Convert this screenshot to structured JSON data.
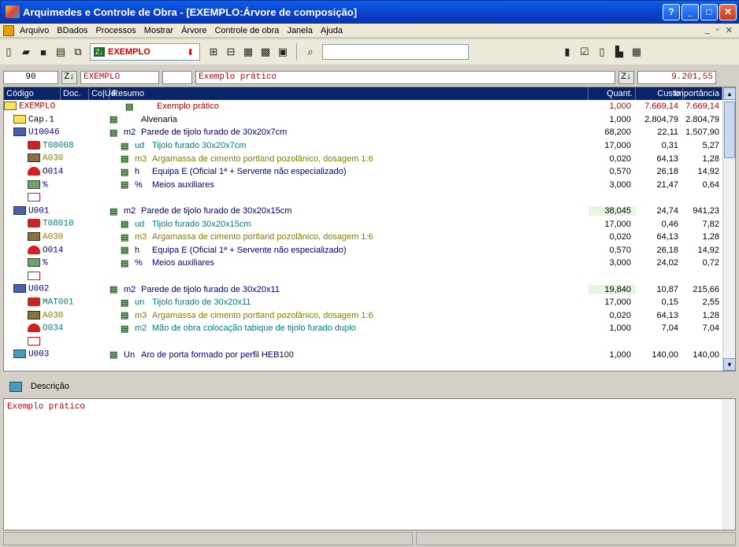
{
  "window": {
    "title": "Arquimedes e Controle de Obra - [EXEMPLO:Árvore de composição]"
  },
  "menu": [
    "Arquivo",
    "BDados",
    "Processos",
    "Mostrar",
    "Árvore",
    "Controle de obra",
    "Janela",
    "Ajuda"
  ],
  "toolbar": {
    "obra_combo": "EXEMPLO"
  },
  "infobar": {
    "count": "90",
    "code": "EXEMPLO",
    "resumo": "Exemplo prático",
    "total": "9.201,55"
  },
  "grid": {
    "headers": {
      "codigo": "Código",
      "doc": "Doc.",
      "col": "Co|Ud",
      "resumo": "Resumo",
      "quant": "Quant.",
      "custo": "Custo",
      "importancia": "Importância"
    },
    "rows": [
      {
        "code": "EXEMPLO",
        "ud": "",
        "resumo": "Exemplo prático",
        "q": "1,000",
        "c": "7.669,14",
        "i": "7.669,14",
        "color": "#c00000",
        "icon": "root",
        "indent": 0
      },
      {
        "code": "Cap.1",
        "ud": "",
        "resumo": "Alvenaria",
        "q": "1,000",
        "c": "2.804,79",
        "i": "2.804,79",
        "color": "#000000",
        "icon": "cap",
        "indent": 1
      },
      {
        "code": "U10046",
        "ud": "m2",
        "resumo": "Parede de tijolo furado de 30x20x7cm",
        "q": "68,200",
        "c": "22,11",
        "i": "1.507,90",
        "color": "#000080",
        "icon": "part",
        "indent": 1
      },
      {
        "code": "T08008",
        "ud": "ud",
        "resumo": "Tijolo furado 30x20x7cm",
        "q": "17,000",
        "c": "0,31",
        "i": "5,27",
        "color": "#008080",
        "icon": "mat",
        "indent": 2
      },
      {
        "code": "A030",
        "ud": "m3",
        "resumo": "Argamassa de cimento portland pozolânico, dosagem 1:6",
        "q": "0,020",
        "c": "64,13",
        "i": "1,28",
        "color": "#808000",
        "icon": "eq",
        "indent": 2
      },
      {
        "code": "O014",
        "ud": "h",
        "resumo": "Equipa E (Oficial 1ª + Servente não especializado)",
        "q": "0,570",
        "c": "26,18",
        "i": "14,92",
        "color": "#000080",
        "icon": "mao",
        "indent": 2
      },
      {
        "code": "%",
        "ud": "%",
        "resumo": "Meios auxiliares",
        "q": "3,000",
        "c": "21,47",
        "i": "0,64",
        "color": "#000080",
        "icon": "pct",
        "indent": 2
      },
      {
        "code": "",
        "ud": "",
        "resumo": "",
        "q": "",
        "c": "",
        "i": "",
        "color": "#000000",
        "icon": "add",
        "indent": 2
      },
      {
        "code": "U001",
        "ud": "m2",
        "resumo": "Parede de tijolo furado de 30x20x15cm",
        "q": "38,045",
        "c": "24,74",
        "i": "941,23",
        "color": "#000080",
        "icon": "part",
        "indent": 1,
        "hl": true
      },
      {
        "code": "T08010",
        "ud": "ud",
        "resumo": "Tijolo furado 30x20x15cm",
        "q": "17,000",
        "c": "0,46",
        "i": "7,82",
        "color": "#008080",
        "icon": "mat",
        "indent": 2
      },
      {
        "code": "A030",
        "ud": "m3",
        "resumo": "Argamassa de cimento portland pozolânico, dosagem 1:6",
        "q": "0,020",
        "c": "64,13",
        "i": "1,28",
        "color": "#808000",
        "icon": "eq",
        "indent": 2
      },
      {
        "code": "O014",
        "ud": "h",
        "resumo": "Equipa E (Oficial 1ª + Servente não especializado)",
        "q": "0,570",
        "c": "26,18",
        "i": "14,92",
        "color": "#000080",
        "icon": "mao",
        "indent": 2
      },
      {
        "code": "%",
        "ud": "%",
        "resumo": "Meios auxiliares",
        "q": "3,000",
        "c": "24,02",
        "i": "0,72",
        "color": "#000080",
        "icon": "pct",
        "indent": 2
      },
      {
        "code": "",
        "ud": "",
        "resumo": "",
        "q": "",
        "c": "",
        "i": "",
        "color": "#000000",
        "icon": "add",
        "indent": 2
      },
      {
        "code": "U002",
        "ud": "m2",
        "resumo": "Parede de tijolo furado de 30x20x11",
        "q": "19,840",
        "c": "10,87",
        "i": "215,66",
        "color": "#000080",
        "icon": "part",
        "indent": 1,
        "hl": true
      },
      {
        "code": "MAT001",
        "ud": "un",
        "resumo": "Tijolo furado de 30x20x11",
        "q": "17,000",
        "c": "0,15",
        "i": "2,55",
        "color": "#008080",
        "icon": "mat",
        "indent": 2
      },
      {
        "code": "A030",
        "ud": "m3",
        "resumo": "Argamassa de cimento portland pozolânico, dosagem 1:6",
        "q": "0,020",
        "c": "64,13",
        "i": "1,28",
        "color": "#808000",
        "icon": "eq",
        "indent": 2
      },
      {
        "code": "O034",
        "ud": "m2",
        "resumo": "Mão de obra colocação tabique de tijolo furado duplo",
        "q": "1,000",
        "c": "7,04",
        "i": "7,04",
        "color": "#008080",
        "icon": "mao",
        "indent": 2
      },
      {
        "code": "",
        "ud": "",
        "resumo": "",
        "q": "",
        "c": "",
        "i": "",
        "color": "#000000",
        "icon": "add",
        "indent": 2
      },
      {
        "code": "U003",
        "ud": "Un",
        "resumo": "Aro de porta formado por perfil HEB100",
        "q": "1,000",
        "c": "140,00",
        "i": "140,00",
        "color": "#000080",
        "icon": "op",
        "indent": 1
      }
    ]
  },
  "description": {
    "label": "Descrição",
    "text": "Exemplo prático"
  }
}
